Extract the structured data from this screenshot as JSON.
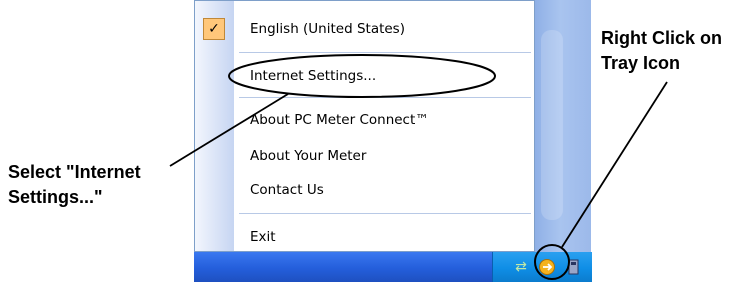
{
  "menu": {
    "items": [
      {
        "label": "English (United States)",
        "checked": true
      },
      {
        "label": "Internet Settings..."
      },
      {
        "label": "About PC Meter Connect™"
      },
      {
        "label": "About Your Meter"
      },
      {
        "label": "Contact Us"
      },
      {
        "label": "Exit"
      }
    ]
  },
  "annotations": {
    "left_callout": "Select \"Internet Settings...\"",
    "right_callout": "Right Click on Tray Icon"
  },
  "tray": {
    "icons": [
      "network-icon",
      "pc-meter-tray-icon",
      "speaker-icon"
    ]
  },
  "colors": {
    "checkbox_bg": "#ffc77a",
    "taskbar": "#245edb",
    "tray": "#0f8ee6"
  }
}
